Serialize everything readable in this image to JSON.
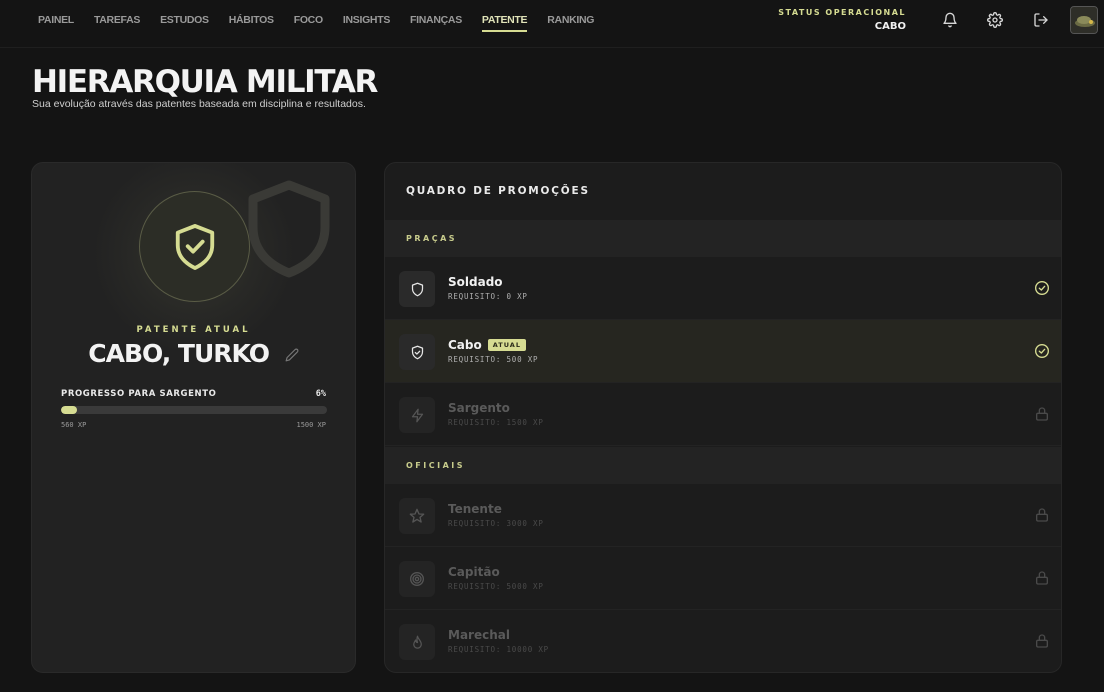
{
  "nav": {
    "items": [
      "PAINEL",
      "TAREFAS",
      "ESTUDOS",
      "HÁBITOS",
      "FOCO",
      "INSIGHTS",
      "FINANÇAS",
      "PATENTE",
      "RANKING"
    ],
    "active": "PATENTE"
  },
  "status": {
    "label": "STATUS OPERACIONAL",
    "value": "CABO"
  },
  "header": {
    "title": "HIERARQUIA MILITAR",
    "subtitle": "Sua evolução através das patentes baseada em disciplina e resultados."
  },
  "current": {
    "label": "PATENTE ATUAL",
    "name": "CABO, TURKO",
    "progress_label": "PROGRESSO PARA SARGENTO",
    "progress_pct_text": "6%",
    "progress_fraction": 0.06,
    "xp_min": "560 XP",
    "xp_max": "1500 XP"
  },
  "board": {
    "title": "QUADRO DE PROMOÇÕES",
    "sections": [
      {
        "label": "PRAÇAS",
        "ranks": [
          {
            "name": "Soldado",
            "req": "REQUISITO: 0 XP",
            "icon": "shield-icon",
            "state": "achieved"
          },
          {
            "name": "Cabo",
            "req": "REQUISITO: 500 XP",
            "icon": "shield-check-icon",
            "state": "current",
            "badge": "ATUAL"
          },
          {
            "name": "Sargento",
            "req": "REQUISITO: 1500 XP",
            "icon": "lightning-icon",
            "state": "locked"
          }
        ]
      },
      {
        "label": "OFICIAIS",
        "ranks": [
          {
            "name": "Tenente",
            "req": "REQUISITO: 3000 XP",
            "icon": "star-icon",
            "state": "locked"
          },
          {
            "name": "Capitão",
            "req": "REQUISITO: 5000 XP",
            "icon": "target-icon",
            "state": "locked"
          },
          {
            "name": "Marechal",
            "req": "REQUISITO: 10000 XP",
            "icon": "flame-icon",
            "state": "locked"
          }
        ]
      }
    ]
  },
  "colors": {
    "accent": "#d6dc92",
    "background": "#141414",
    "card": "#222222"
  }
}
